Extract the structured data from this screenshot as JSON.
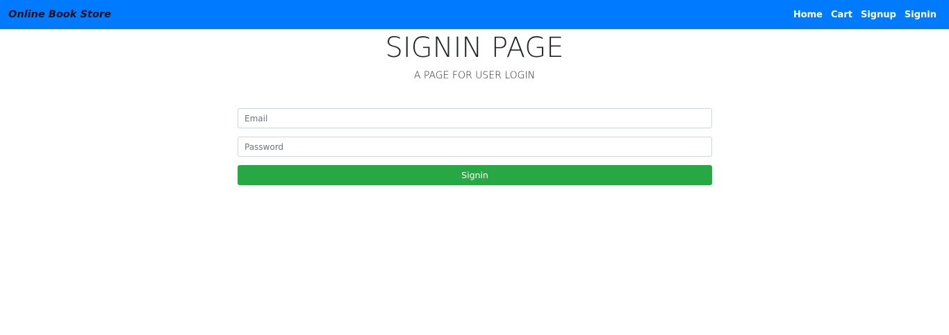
{
  "navbar": {
    "brand": "Online Book Store",
    "background_color": "#007bff",
    "links": [
      {
        "label": "Home"
      },
      {
        "label": "Cart"
      },
      {
        "label": "Signup"
      },
      {
        "label": "Signin"
      }
    ]
  },
  "page": {
    "title": "SIGNIN PAGE",
    "subtitle": "A PAGE FOR USER LOGIN"
  },
  "form": {
    "email": {
      "placeholder": "Email",
      "value": ""
    },
    "password": {
      "placeholder": "Password",
      "value": ""
    },
    "submit_label": "Signin",
    "submit_color": "#28a745"
  }
}
